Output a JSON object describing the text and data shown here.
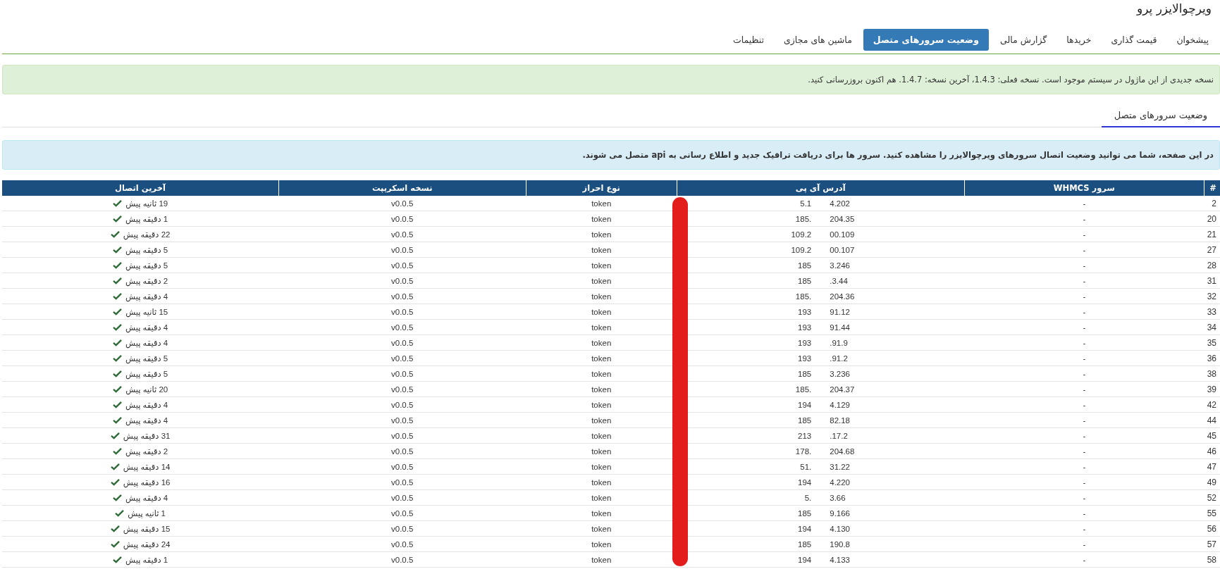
{
  "title": "ویرچوالایزر پرو",
  "tabs": [
    {
      "label": "پیشخوان",
      "selected": false
    },
    {
      "label": "قیمت گذاری",
      "selected": false
    },
    {
      "label": "خریدها",
      "selected": false
    },
    {
      "label": "گزارش مالی",
      "selected": false
    },
    {
      "label": "وضعیت سرورهای متصل",
      "selected": true
    },
    {
      "label": "ماشین های مجازی",
      "selected": false
    },
    {
      "label": "تنظیمات",
      "selected": false
    }
  ],
  "update_alert": "نسخه جدیدی از این ماژول در سیستم موجود است. نسخه فعلی: 1.4.3، آخرین نسخه: 1.4.7. هم اکنون بروزرسانی کنید.",
  "section_tabs": [
    {
      "label": "وضعیت سرورهای متصل",
      "selected": true
    }
  ],
  "info_alert": "در این صفحه، شما می توانید وضعیت اتصال سرورهای ویرچوالایزر را مشاهده کنید. سرور ها برای دریافت ترافیک جدید و اطلاع رسانی به api متصل می شوند.",
  "table": {
    "columns": [
      "#",
      "سرور WHMCS",
      "آدرس آی پی",
      "نوع احراز",
      "نسخه اسکریپت",
      "آخرین اتصال"
    ],
    "rows": [
      {
        "id": "2",
        "whmcs": "-",
        "ip_start": "5.1",
        "ip_end": "4.202",
        "auth": "token",
        "script": "v0.0.5",
        "last_seen": "19 ثانیه پیش",
        "online": true
      },
      {
        "id": "20",
        "whmcs": "-",
        "ip_start": "185.",
        "ip_end": "204.35",
        "auth": "token",
        "script": "v0.0.5",
        "last_seen": "1 دقیقه پیش",
        "online": true
      },
      {
        "id": "21",
        "whmcs": "-",
        "ip_start": "109.2",
        "ip_end": "00.109",
        "auth": "token",
        "script": "v0.0.5",
        "last_seen": "22 دقیقه پیش",
        "online": true
      },
      {
        "id": "27",
        "whmcs": "-",
        "ip_start": "109.2",
        "ip_end": "00.107",
        "auth": "token",
        "script": "v0.0.5",
        "last_seen": "5 دقیقه پیش",
        "online": true
      },
      {
        "id": "28",
        "whmcs": "-",
        "ip_start": "185",
        "ip_end": "3.246",
        "auth": "token",
        "script": "v0.0.5",
        "last_seen": "5 دقیقه پیش",
        "online": true
      },
      {
        "id": "31",
        "whmcs": "-",
        "ip_start": "185",
        "ip_end": ".3.44",
        "auth": "token",
        "script": "v0.0.5",
        "last_seen": "2 دقیقه پیش",
        "online": true
      },
      {
        "id": "32",
        "whmcs": "-",
        "ip_start": "185.",
        "ip_end": "204.36",
        "auth": "token",
        "script": "v0.0.5",
        "last_seen": "4 دقیقه پیش",
        "online": true
      },
      {
        "id": "33",
        "whmcs": "-",
        "ip_start": "193",
        "ip_end": "91.12",
        "auth": "token",
        "script": "v0.0.5",
        "last_seen": "15 ثانیه پیش",
        "online": true
      },
      {
        "id": "34",
        "whmcs": "-",
        "ip_start": "193",
        "ip_end": "91.44",
        "auth": "token",
        "script": "v0.0.5",
        "last_seen": "4 دقیقه پیش",
        "online": true
      },
      {
        "id": "35",
        "whmcs": "-",
        "ip_start": "193",
        "ip_end": ".91.9",
        "auth": "token",
        "script": "v0.0.5",
        "last_seen": "4 دقیقه پیش",
        "online": true
      },
      {
        "id": "36",
        "whmcs": "-",
        "ip_start": "193",
        "ip_end": ".91.2",
        "auth": "token",
        "script": "v0.0.5",
        "last_seen": "5 دقیقه پیش",
        "online": true
      },
      {
        "id": "38",
        "whmcs": "-",
        "ip_start": "185",
        "ip_end": "3.236",
        "auth": "token",
        "script": "v0.0.5",
        "last_seen": "5 دقیقه پیش",
        "online": true
      },
      {
        "id": "39",
        "whmcs": "-",
        "ip_start": "185.",
        "ip_end": "204.37",
        "auth": "token",
        "script": "v0.0.5",
        "last_seen": "20 ثانیه پیش",
        "online": true
      },
      {
        "id": "42",
        "whmcs": "-",
        "ip_start": "194",
        "ip_end": "4.129",
        "auth": "token",
        "script": "v0.0.5",
        "last_seen": "4 دقیقه پیش",
        "online": true
      },
      {
        "id": "44",
        "whmcs": "-",
        "ip_start": "185",
        "ip_end": "82.18",
        "auth": "token",
        "script": "v0.0.5",
        "last_seen": "4 دقیقه پیش",
        "online": true
      },
      {
        "id": "45",
        "whmcs": "-",
        "ip_start": "213",
        "ip_end": ".17.2",
        "auth": "token",
        "script": "v0.0.5",
        "last_seen": "31 دقیقه پیش",
        "online": true
      },
      {
        "id": "46",
        "whmcs": "-",
        "ip_start": "178.",
        "ip_end": "204.68",
        "auth": "token",
        "script": "v0.0.5",
        "last_seen": "2 دقیقه پیش",
        "online": true
      },
      {
        "id": "47",
        "whmcs": "-",
        "ip_start": "51.",
        "ip_end": "31.22",
        "auth": "token",
        "script": "v0.0.5",
        "last_seen": "14 دقیقه پیش",
        "online": true
      },
      {
        "id": "49",
        "whmcs": "-",
        "ip_start": "194",
        "ip_end": "4.220",
        "auth": "token",
        "script": "v0.0.5",
        "last_seen": "16 دقیقه پیش",
        "online": true
      },
      {
        "id": "52",
        "whmcs": "-",
        "ip_start": "5.",
        "ip_end": "3.66",
        "auth": "token",
        "script": "v0.0.5",
        "last_seen": "4 دقیقه پیش",
        "online": true
      },
      {
        "id": "55",
        "whmcs": "-",
        "ip_start": "185",
        "ip_end": "9.166",
        "auth": "token",
        "script": "v0.0.5",
        "last_seen": "1 ثانیه پیش",
        "online": true
      },
      {
        "id": "56",
        "whmcs": "-",
        "ip_start": "194",
        "ip_end": "4.130",
        "auth": "token",
        "script": "v0.0.5",
        "last_seen": "15 دقیقه پیش",
        "online": true
      },
      {
        "id": "57",
        "whmcs": "-",
        "ip_start": "185",
        "ip_end": "190.8",
        "auth": "token",
        "script": "v0.0.5",
        "last_seen": "24 دقیقه پیش",
        "online": true
      },
      {
        "id": "58",
        "whmcs": "-",
        "ip_start": "194",
        "ip_end": "4.133",
        "auth": "token",
        "script": "v0.0.5",
        "last_seen": "1 دقیقه پیش",
        "online": true
      }
    ]
  }
}
